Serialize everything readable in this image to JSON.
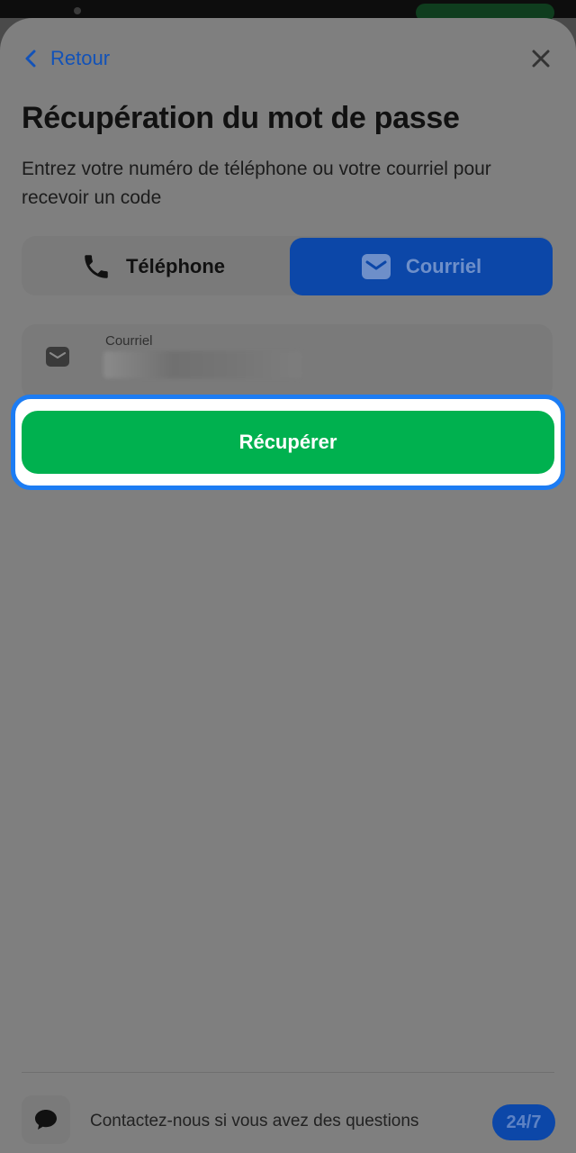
{
  "header": {
    "back_label": "Retour"
  },
  "title": "Récupération du mot de passe",
  "subtitle": "Entrez votre numéro de téléphone ou votre courriel pour recevoir un code",
  "tabs": [
    {
      "label": "Téléphone",
      "icon": "phone-icon",
      "selected": false
    },
    {
      "label": "Courriel",
      "icon": "mail-icon",
      "selected": true
    }
  ],
  "email_field": {
    "label": "Courriel",
    "icon": "mail-icon"
  },
  "submit_label": "Récupérer",
  "footer": {
    "contact_text": "Contactez-nous si vous avez des questions",
    "badge": "24/7",
    "icon": "chat-bubble-icon"
  },
  "colors": {
    "accent_blue": "#1252b8",
    "primary_green": "#00b14f",
    "focus_ring": "#1c7cf3"
  }
}
